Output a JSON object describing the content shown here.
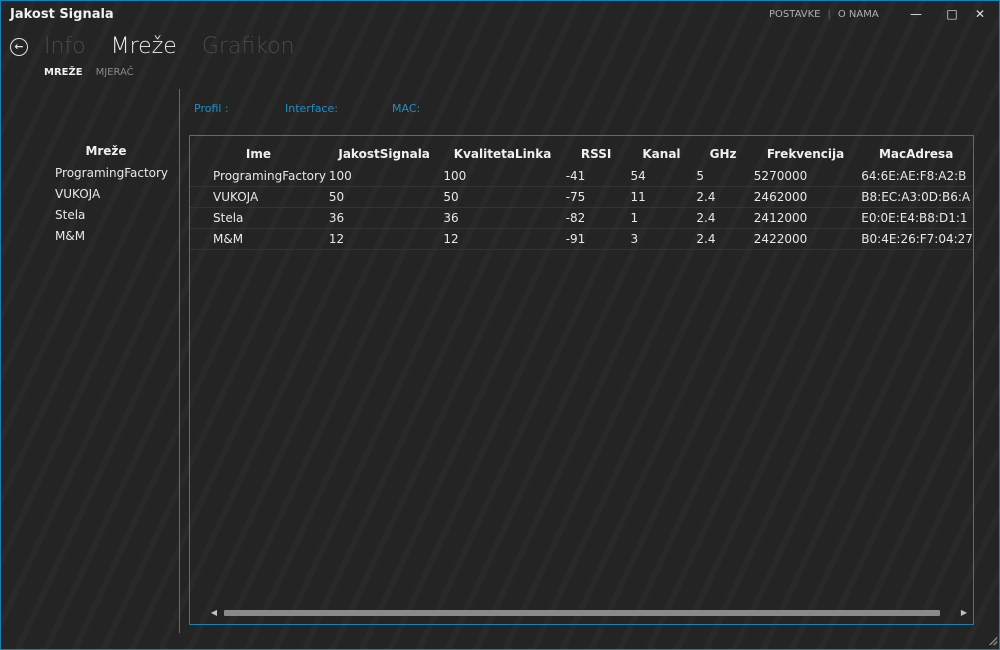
{
  "window": {
    "title": "Jakost Signala",
    "links": [
      "POSTAVKE",
      "O NAMA"
    ]
  },
  "nav": {
    "tabs": [
      {
        "label": "Info"
      },
      {
        "label": "Mreže"
      },
      {
        "label": "Grafikon"
      }
    ],
    "active_tab": "Mreže",
    "subtabs": [
      {
        "label": "MREŽE"
      },
      {
        "label": "MJERAČ"
      }
    ],
    "active_subtab": "MREŽE"
  },
  "sidebar": {
    "header": "Mreže",
    "items": [
      "ProgramingFactory",
      "VUKOJA",
      "Stela",
      "M&M"
    ]
  },
  "info": {
    "profil_label": "Profil :",
    "interface_label": "Interface:",
    "mac_label": "MAC:"
  },
  "table": {
    "columns": [
      "Ime",
      "JakostSignala",
      "KvalitetaLinka",
      "RSSI",
      "Kanal",
      "GHz",
      "Frekvencija",
      "MacAdresa"
    ],
    "rows": [
      [
        "ProgramingFactory",
        "100",
        "100",
        "-41",
        "54",
        "5",
        "5270000",
        "64:6E:AE:F8:A2:B"
      ],
      [
        "VUKOJA",
        "50",
        "50",
        "-75",
        "11",
        "2.4",
        "2462000",
        "B8:EC:A3:0D:B6:A"
      ],
      [
        "Stela",
        "36",
        "36",
        "-82",
        "1",
        "2.4",
        "2412000",
        "E0:0E:E4:B8:D1:1"
      ],
      [
        "M&M",
        "12",
        "12",
        "-91",
        "3",
        "2.4",
        "2422000",
        "B0:4E:26:F7:04:27"
      ]
    ]
  },
  "accent_color": "#1e8fc8"
}
